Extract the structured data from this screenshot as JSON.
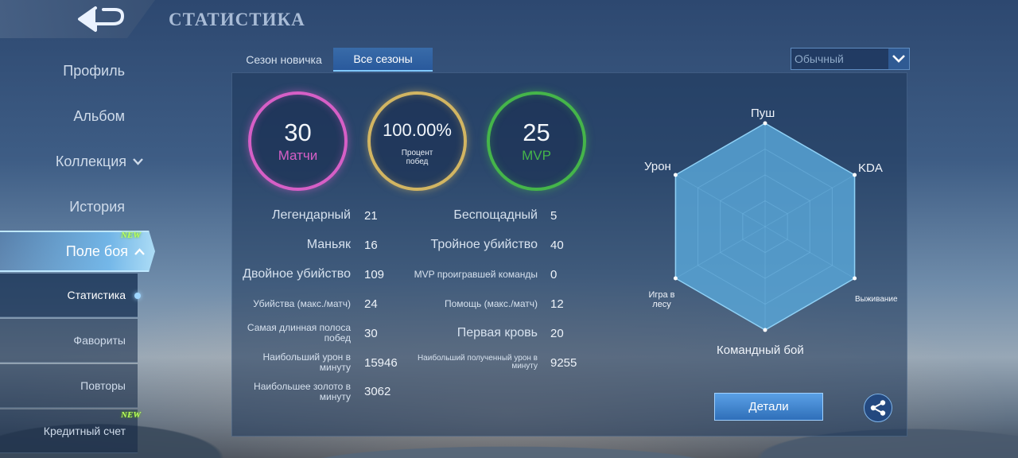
{
  "header": {
    "title": "СТАТИСТИКА",
    "back_icon": "back-arrow-icon"
  },
  "sidebar": {
    "items": [
      {
        "label": "Профиль"
      },
      {
        "label": "Альбом"
      },
      {
        "label": "Коллекция",
        "chevron": "⌄"
      },
      {
        "label": "История"
      },
      {
        "label": "Поле боя",
        "chevron": "⌃",
        "badge": "NEW"
      }
    ],
    "subitems": [
      {
        "label": "Статистика"
      },
      {
        "label": "Фавориты"
      },
      {
        "label": "Повторы"
      },
      {
        "label": "Кредитный счет",
        "badge": "NEW"
      }
    ]
  },
  "tabs": [
    {
      "label": "Сезон новичка"
    },
    {
      "label": "Все сезоны"
    }
  ],
  "dropdown": {
    "value": "Обычный"
  },
  "circles": [
    {
      "value": "30",
      "label": "Матчи",
      "color": "#d65fc6"
    },
    {
      "value": "100.00%",
      "label": "Процент побед",
      "color": "#d2b562"
    },
    {
      "value": "25",
      "label": "MVP",
      "color": "#45b54a"
    }
  ],
  "stats_left": [
    {
      "label": "Легендарный",
      "value": "21"
    },
    {
      "label": "Маньяк",
      "value": "16"
    },
    {
      "label": "Двойное убийство",
      "value": "109"
    },
    {
      "label": "Убийства (макс./матч)",
      "value": "24"
    },
    {
      "label": "Самая длинная полоса побед",
      "value": "30"
    },
    {
      "label": "Наибольший урон в минуту",
      "value": "15946"
    },
    {
      "label": "Наибольшее золото в минуту",
      "value": "3062"
    }
  ],
  "stats_right": [
    {
      "label": "Беспощадный",
      "value": "5"
    },
    {
      "label": "Тройное убийство",
      "value": "40"
    },
    {
      "label": "MVP проигравшей команды",
      "value": "0"
    },
    {
      "label": "Помощь (макс./матч)",
      "value": "12"
    },
    {
      "label": "Первая кровь",
      "value": "20"
    },
    {
      "label": "Наибольший полученный урон в минуту",
      "value": "9255"
    }
  ],
  "radar": {
    "axes": [
      "Пуш",
      "KDA",
      "Выживание",
      "Командный бой",
      "Игра в лесу",
      "Урон"
    ],
    "values": [
      1.0,
      1.0,
      1.0,
      1.0,
      1.0,
      1.0
    ],
    "fill_color": "#5fb3e4"
  },
  "buttons": {
    "details": "Детали",
    "share_icon": "share-icon"
  }
}
